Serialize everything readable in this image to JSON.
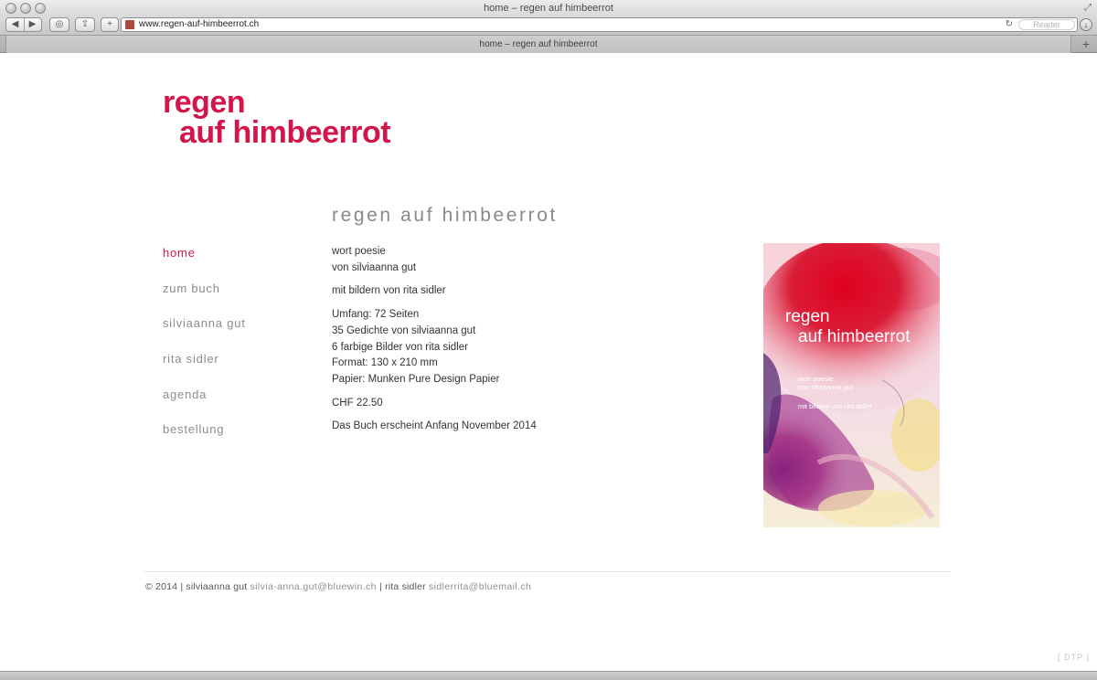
{
  "browser": {
    "window_title": "home – regen auf himbeerrot",
    "tab_title": "home – regen auf himbeerrot",
    "url": "www.regen-auf-himbeerrot.ch",
    "reader_label": "Reader",
    "icons": [
      "back-icon",
      "forward-icon",
      "history-icon",
      "share-icon",
      "add-bookmark-icon",
      "reload-icon",
      "download-icon",
      "fullscreen-icon",
      "new-tab-icon"
    ]
  },
  "site": {
    "logo_line1": "regen",
    "logo_line2": "auf himbeerrot",
    "brand_color": "#d2164a",
    "heading": "regen auf himbeerrot",
    "nav": [
      {
        "label": "home",
        "active": true
      },
      {
        "label": "zum buch",
        "active": false
      },
      {
        "label": "silviaanna gut",
        "active": false
      },
      {
        "label": "rita sidler",
        "active": false
      },
      {
        "label": "agenda",
        "active": false
      },
      {
        "label": "bestellung",
        "active": false
      }
    ],
    "content": {
      "p1_line1": "wort poesie",
      "p1_line2": "von silviaanna gut",
      "p2": "mit bildern von rita sidler",
      "p3_lines": [
        "Umfang: 72 Seiten",
        "35 Gedichte von silviaanna gut",
        "6 farbige Bilder von rita sidler",
        "Format: 130 x 210 mm",
        "Papier: Munken Pure Design Papier"
      ],
      "price": "CHF 22.50",
      "release": "Das Buch erscheint Anfang November 2014"
    },
    "cover": {
      "title_line1": "regen",
      "title_line2": "auf himbeerrot",
      "sub1": "wort poesie",
      "sub2": "von silviaanna gut",
      "sub3": "mit bildern von rita sidler"
    },
    "footer": {
      "prefix": "© 2014 | silviaanna gut",
      "email1": "silvia-anna.gut@bluewin.ch",
      "mid": "| rita sidler",
      "email2": "sidlerrita@bluemail.ch"
    },
    "dtp": "[ DTP ]"
  }
}
